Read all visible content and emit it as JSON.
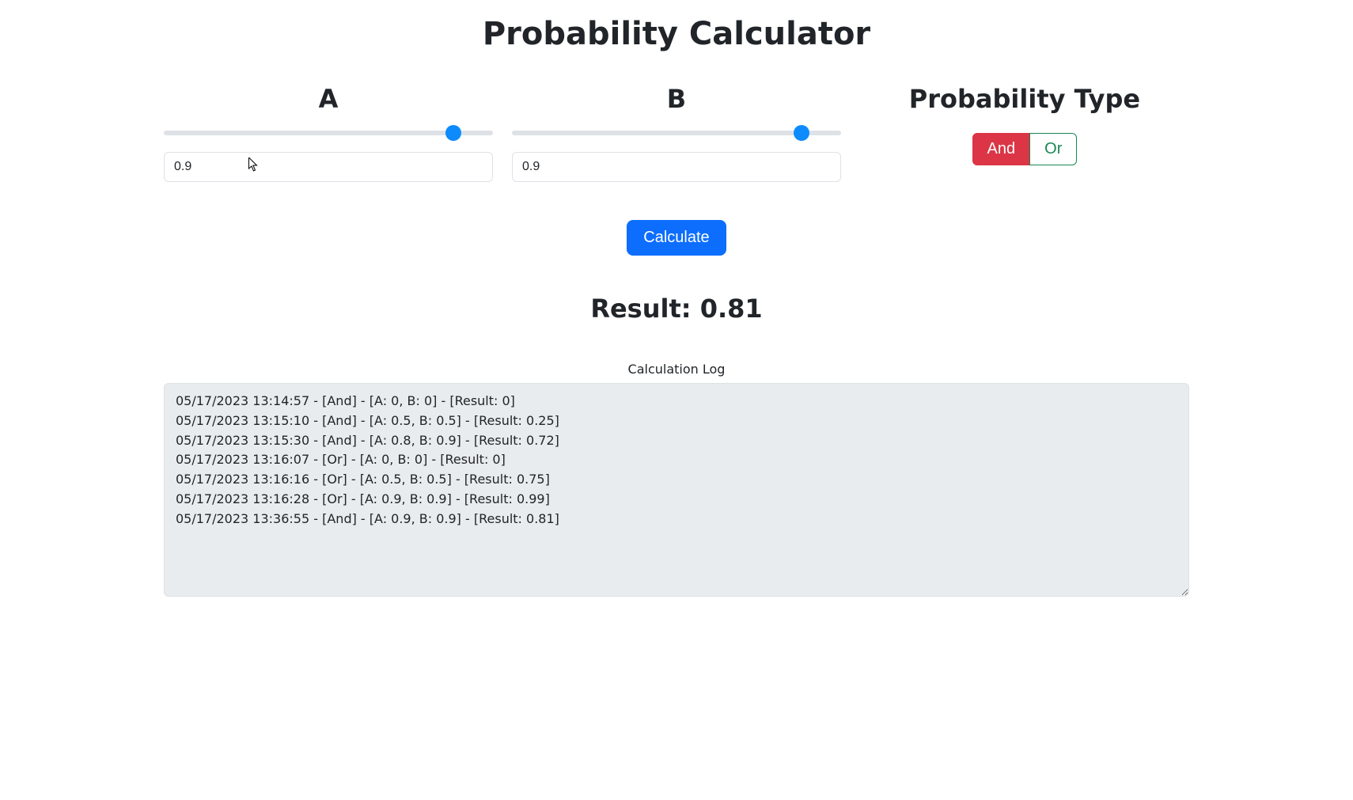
{
  "page": {
    "title": "Probability Calculator"
  },
  "sliderA": {
    "label": "A",
    "value": "0.9",
    "min": "0",
    "max": "1",
    "step": "0.01"
  },
  "sliderB": {
    "label": "B",
    "value": "0.9",
    "min": "0",
    "max": "1",
    "step": "0.01"
  },
  "probType": {
    "heading": "Probability Type",
    "and": {
      "label": "And",
      "active": true
    },
    "or": {
      "label": "Or",
      "active": false
    }
  },
  "calculate": {
    "label": "Calculate"
  },
  "result": {
    "prefix": "Result: ",
    "value": "0.81"
  },
  "log": {
    "label": "Calculation Log",
    "entries": [
      "05/17/2023 13:14:57 - [And] - [A: 0, B: 0] - [Result: 0]",
      "05/17/2023 13:15:10 - [And] - [A: 0.5, B: 0.5] - [Result: 0.25]",
      "05/17/2023 13:15:30 - [And] - [A: 0.8, B: 0.9] - [Result: 0.72]",
      "05/17/2023 13:16:07 - [Or] - [A: 0, B: 0] - [Result: 0]",
      "05/17/2023 13:16:16 - [Or] - [A: 0.5, B: 0.5] - [Result: 0.75]",
      "05/17/2023 13:16:28 - [Or] - [A: 0.9, B: 0.9] - [Result: 0.99]",
      "05/17/2023 13:36:55 - [And] - [A: 0.9, B: 0.9] - [Result: 0.81]"
    ]
  }
}
